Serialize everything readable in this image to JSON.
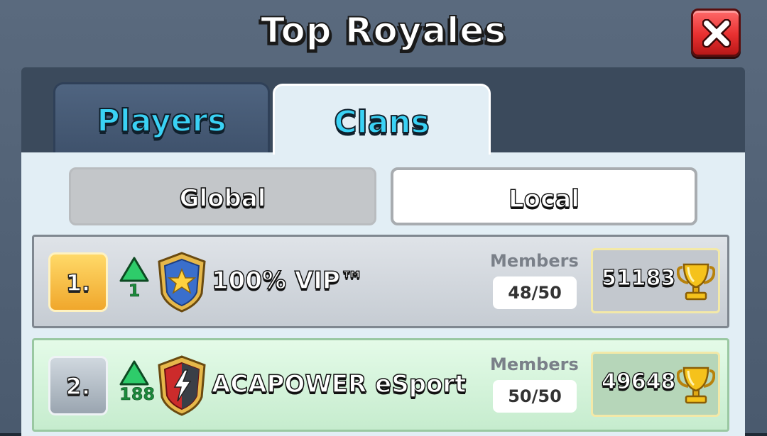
{
  "window": {
    "title": "Top Royales"
  },
  "tabs": [
    {
      "label": "Players",
      "active": false
    },
    {
      "label": "Clans",
      "active": true
    }
  ],
  "filters": [
    {
      "label": "Global",
      "selected": false
    },
    {
      "label": "Local",
      "selected": true
    }
  ],
  "members_label": "Members",
  "clans": [
    {
      "rank": "1.",
      "rank_change": "1",
      "name": "100% VIP™",
      "members": "48/50",
      "trophies": "51183",
      "badge_icon": "star-shield-icon"
    },
    {
      "rank": "2.",
      "rank_change": "188",
      "name": "ACAPOWER eSport",
      "members": "50/50",
      "trophies": "49648",
      "badge_icon": "lightning-shield-icon"
    }
  ],
  "colors": {
    "accent_tab_text": "#3ad2f5",
    "close_button": "#e83030",
    "rank_up": "#1c8a3c",
    "gold_rank": "#f0a72c"
  }
}
